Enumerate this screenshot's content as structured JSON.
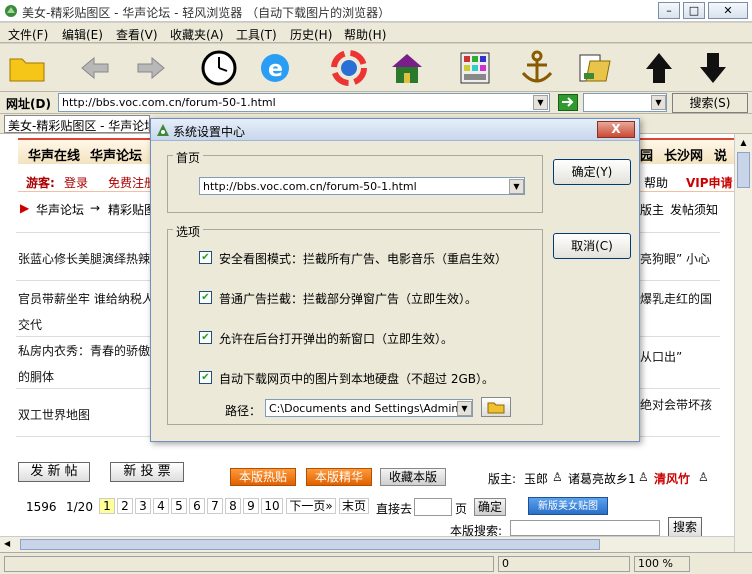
{
  "window": {
    "title": "美女-精彩贴图区 - 华声论坛 - 轻风浏览器  （自动下载图片的浏览器）",
    "controls": {
      "minimize": "–",
      "restore": "□",
      "close": "✕"
    }
  },
  "menu": [
    "文件(F)",
    "编辑(E)",
    "查看(V)",
    "收藏夹(A)",
    "工具(T)",
    "历史(H)",
    "帮助(H)"
  ],
  "toolbar": {
    "icons": [
      "folder-icon",
      "back-icon",
      "forward-icon",
      "clock-icon",
      "ie-icon",
      "refresh-icon",
      "home-icon",
      "grid-icon",
      "anchor-icon",
      "save-icon",
      "up-icon",
      "down-icon"
    ]
  },
  "address": {
    "label": "网址(D)",
    "url": "http://bbs.voc.com.cn/forum-50-1.html",
    "search_button": "搜索(S)"
  },
  "tabs": [
    {
      "label": "美女-精彩贴图区 - 华声论坛"
    }
  ],
  "page": {
    "nav1": [
      "华声在线",
      "华声论坛"
    ],
    "nav1_right": [
      "园",
      "长沙网",
      "说"
    ],
    "nav2_left": [
      "游客:",
      "登录",
      "免费注册"
    ],
    "nav2_right": [
      "帮助",
      "VIP申请"
    ],
    "crumb": [
      "华声论坛",
      "→",
      "精彩贴图"
    ],
    "crumb_right": [
      "版主",
      "发帖须知"
    ],
    "posts": [
      {
        "left": "张蓝心修长美腿演绎热辣",
        "right": "亮狗眼” 小心"
      },
      {
        "left": "官员带薪坐牢  谁给纳税人",
        "right": "爆乳走红的国",
        "line2": "交代"
      },
      {
        "left": "私房内衣秀：青春的骄傲",
        "right": "从口出”",
        "line2": "的胴体"
      },
      {
        "left": "双工世界地图",
        "right": "绝对会带坏孩"
      }
    ],
    "buttons": {
      "post": "发 新 帖",
      "vote": "新 投 票",
      "hot": "本版热贴",
      "elite": "本版精华",
      "fav": "收藏本版"
    },
    "moderators": {
      "label": "版主:",
      "names": [
        "玉郎",
        "诸葛亮故乡1",
        "清风竹"
      ]
    },
    "pager": {
      "total": "1596",
      "page": "1/20",
      "pages": [
        "1",
        "2",
        "3",
        "4",
        "5",
        "6",
        "7",
        "8",
        "9",
        "10"
      ],
      "next": "下一页»",
      "last": "末页",
      "goto_label": "直接去",
      "goto_unit": "页",
      "goto_btn": "确定",
      "new_post": "新版美女贴图"
    },
    "search_label": "本版搜索:",
    "search_btn": "搜索"
  },
  "status": {
    "progress": "0",
    "zoom": "100 %"
  },
  "dialog": {
    "title": "系统设置中心",
    "close": "X",
    "home_group": "首页",
    "home_url": "http://bbs.voc.com.cn/forum-50-1.html",
    "options_group": "选项",
    "options": [
      {
        "label": "安全看图模式：拦截所有广告、电影音乐（重启生效）",
        "checked": true
      },
      {
        "label": "普通广告拦截：拦截部分弹窗广告（立即生效）。",
        "checked": true
      },
      {
        "label": "允许在后台打开弹出的新窗口（立即生效）。",
        "checked": true
      },
      {
        "label": "自动下载网页中的图片到本地硬盘（不超过 2GB）。",
        "checked": true
      }
    ],
    "path_label": "路径：",
    "path_value": "C:\\Documents and Settings\\Administrato",
    "ok": "确定(Y)",
    "cancel": "取消(C)"
  }
}
